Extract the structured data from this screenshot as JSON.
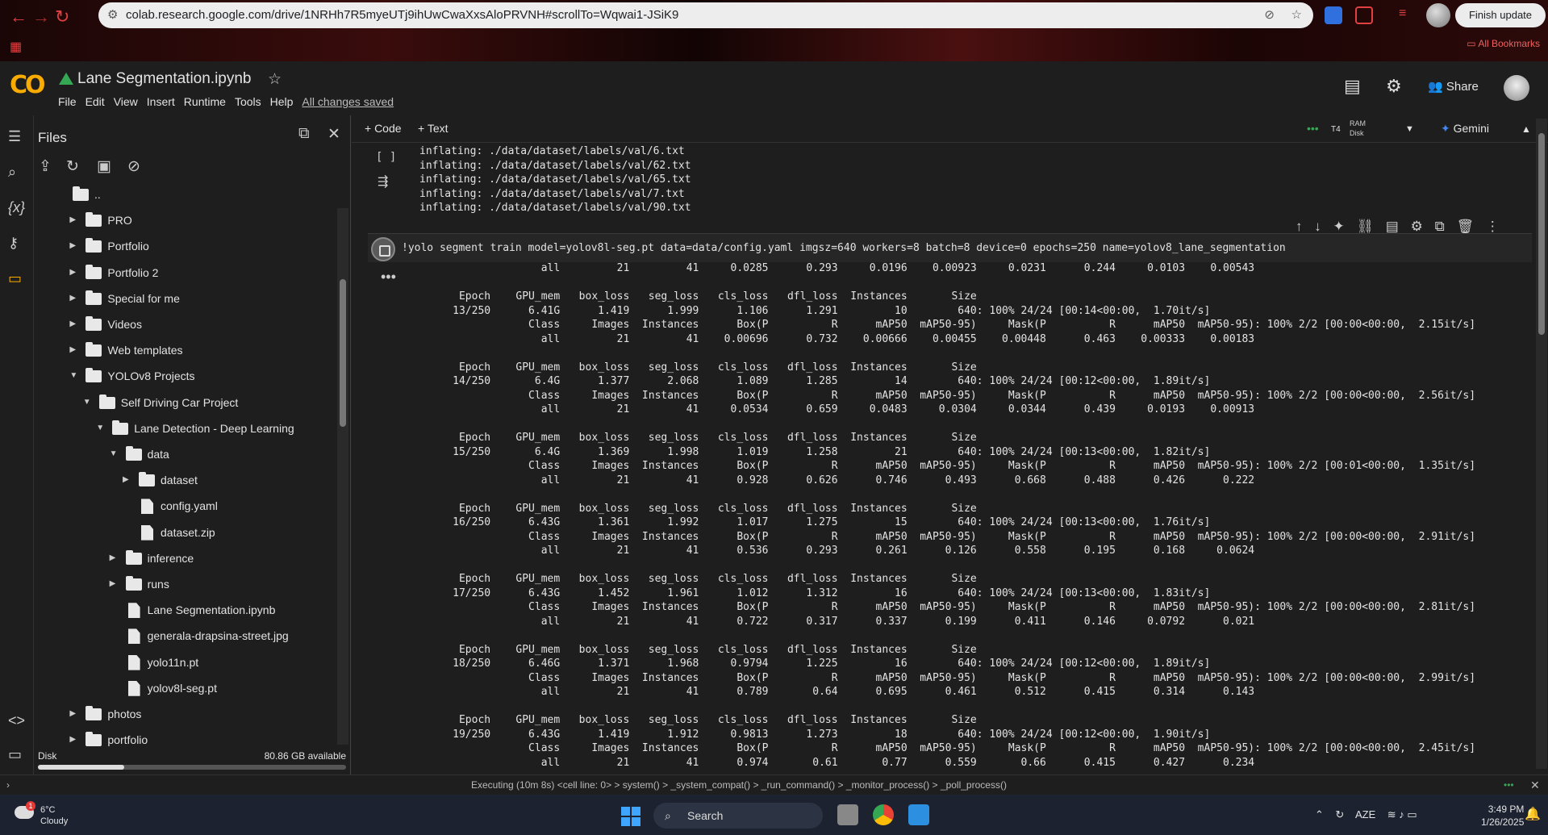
{
  "browser": {
    "url": "colab.research.google.com/drive/1NRHh7R5myeUTj9ihUwCwaXxsAloPRVNH#scrollTo=Wqwai1-JSiK9",
    "finish_update": "Finish update",
    "all_bookmarks": "All Bookmarks"
  },
  "colab": {
    "title": "Lane Segmentation.ipynb",
    "menu": [
      "File",
      "Edit",
      "View",
      "Insert",
      "Runtime",
      "Tools",
      "Help"
    ],
    "saved_status": "All changes saved",
    "share": "Share"
  },
  "files": {
    "title": "Files",
    "disk_label": "Disk",
    "disk_available": "80.86 GB available",
    "disk_used_fraction": 0.28,
    "tree": [
      {
        "name": "..",
        "indent": 0,
        "type": "folder",
        "chevron": ""
      },
      {
        "name": "PRO",
        "indent": 1,
        "type": "folder",
        "chevron": "right"
      },
      {
        "name": "Portfolio",
        "indent": 1,
        "type": "folder",
        "chevron": "right"
      },
      {
        "name": "Portfolio 2",
        "indent": 1,
        "type": "folder",
        "chevron": "right"
      },
      {
        "name": "Special for me",
        "indent": 1,
        "type": "folder",
        "chevron": "right"
      },
      {
        "name": "Videos",
        "indent": 1,
        "type": "folder",
        "chevron": "right"
      },
      {
        "name": "Web templates",
        "indent": 1,
        "type": "folder",
        "chevron": "right"
      },
      {
        "name": "YOLOv8 Projects",
        "indent": 1,
        "type": "folder",
        "chevron": "down"
      },
      {
        "name": "Self Driving Car Project",
        "indent": 2,
        "type": "folder",
        "chevron": "down"
      },
      {
        "name": "Lane Detection - Deep Learning",
        "indent": 3,
        "type": "folder",
        "chevron": "down"
      },
      {
        "name": "data",
        "indent": 4,
        "type": "folder",
        "chevron": "down"
      },
      {
        "name": "dataset",
        "indent": 5,
        "type": "folder",
        "chevron": "right"
      },
      {
        "name": "config.yaml",
        "indent": 5,
        "type": "file",
        "chevron": ""
      },
      {
        "name": "dataset.zip",
        "indent": 5,
        "type": "file",
        "chevron": ""
      },
      {
        "name": "inference",
        "indent": 4,
        "type": "folder",
        "chevron": "right"
      },
      {
        "name": "runs",
        "indent": 4,
        "type": "folder",
        "chevron": "right"
      },
      {
        "name": "Lane Segmentation.ipynb",
        "indent": 4,
        "type": "file",
        "chevron": ""
      },
      {
        "name": "generala-drapsina-street.jpg",
        "indent": 4,
        "type": "file",
        "chevron": ""
      },
      {
        "name": "yolo11n.pt",
        "indent": 4,
        "type": "file",
        "chevron": ""
      },
      {
        "name": "yolov8l-seg.pt",
        "indent": 4,
        "type": "file",
        "chevron": ""
      },
      {
        "name": "photos",
        "indent": 1,
        "type": "folder",
        "chevron": "right"
      },
      {
        "name": "portfolio",
        "indent": 1,
        "type": "folder",
        "chevron": "right"
      }
    ]
  },
  "toolbar": {
    "code": "+ Code",
    "text": "+ Text",
    "gpu": "T4",
    "ram": "RAM",
    "disk": "Disk",
    "gemini": "Gemini"
  },
  "cell": {
    "bracket": "[ ]",
    "top_output": "inflating: ./data/dataset/labels/val/6.txt\ninflating: ./data/dataset/labels/val/62.txt\ninflating: ./data/dataset/labels/val/65.txt\ninflating: ./data/dataset/labels/val/7.txt\ninflating: ./data/dataset/labels/val/90.txt",
    "code": "!yolo segment train model=yolov8l-seg.pt data=data/config.yaml imgsz=640 workers=8 batch=8 device=0 epochs=250 name=yolov8_lane_segmentation",
    "output": "                   all         21         41     0.0285      0.293     0.0196    0.00923     0.0231      0.244     0.0103    0.00543\n\n      Epoch    GPU_mem   box_loss   seg_loss   cls_loss   dfl_loss  Instances       Size\n     13/250      6.41G      1.419      1.999      1.106      1.291         10        640: 100% 24/24 [00:14<00:00,  1.70it/s]\n                 Class     Images  Instances      Box(P          R      mAP50  mAP50-95)     Mask(P          R      mAP50  mAP50-95): 100% 2/2 [00:00<00:00,  2.15it/s]\n                   all         21         41    0.00696      0.732    0.00666    0.00455    0.00448      0.463    0.00333    0.00183\n\n      Epoch    GPU_mem   box_loss   seg_loss   cls_loss   dfl_loss  Instances       Size\n     14/250       6.4G      1.377      2.068      1.089      1.285         14        640: 100% 24/24 [00:12<00:00,  1.89it/s]\n                 Class     Images  Instances      Box(P          R      mAP50  mAP50-95)     Mask(P          R      mAP50  mAP50-95): 100% 2/2 [00:00<00:00,  2.56it/s]\n                   all         21         41     0.0534      0.659     0.0483     0.0304     0.0344      0.439     0.0193    0.00913\n\n      Epoch    GPU_mem   box_loss   seg_loss   cls_loss   dfl_loss  Instances       Size\n     15/250       6.4G      1.369      1.998      1.019      1.258         21        640: 100% 24/24 [00:13<00:00,  1.82it/s]\n                 Class     Images  Instances      Box(P          R      mAP50  mAP50-95)     Mask(P          R      mAP50  mAP50-95): 100% 2/2 [00:01<00:00,  1.35it/s]\n                   all         21         41      0.928      0.626      0.746      0.493      0.668      0.488      0.426      0.222\n\n      Epoch    GPU_mem   box_loss   seg_loss   cls_loss   dfl_loss  Instances       Size\n     16/250      6.43G      1.361      1.992      1.017      1.275         15        640: 100% 24/24 [00:13<00:00,  1.76it/s]\n                 Class     Images  Instances      Box(P          R      mAP50  mAP50-95)     Mask(P          R      mAP50  mAP50-95): 100% 2/2 [00:00<00:00,  2.91it/s]\n                   all         21         41      0.536      0.293      0.261      0.126      0.558      0.195      0.168     0.0624\n\n      Epoch    GPU_mem   box_loss   seg_loss   cls_loss   dfl_loss  Instances       Size\n     17/250      6.43G      1.452      1.961      1.012      1.312         16        640: 100% 24/24 [00:13<00:00,  1.83it/s]\n                 Class     Images  Instances      Box(P          R      mAP50  mAP50-95)     Mask(P          R      mAP50  mAP50-95): 100% 2/2 [00:00<00:00,  2.81it/s]\n                   all         21         41      0.722      0.317      0.337      0.199      0.411      0.146     0.0792      0.021\n\n      Epoch    GPU_mem   box_loss   seg_loss   cls_loss   dfl_loss  Instances       Size\n     18/250      6.46G      1.371      1.968     0.9794      1.225         16        640: 100% 24/24 [00:12<00:00,  1.89it/s]\n                 Class     Images  Instances      Box(P          R      mAP50  mAP50-95)     Mask(P          R      mAP50  mAP50-95): 100% 2/2 [00:00<00:00,  2.99it/s]\n                   all         21         41      0.789       0.64      0.695      0.461      0.512      0.415      0.314      0.143\n\n      Epoch    GPU_mem   box_loss   seg_loss   cls_loss   dfl_loss  Instances       Size\n     19/250      6.43G      1.419      1.912     0.9813      1.273         18        640: 100% 24/24 [00:12<00:00,  1.90it/s]\n                 Class     Images  Instances      Box(P          R      mAP50  mAP50-95)     Mask(P          R      mAP50  mAP50-95): 100% 2/2 [00:00<00:00,  2.45it/s]\n                   all         21         41      0.974       0.61       0.77      0.559       0.66      0.415      0.427      0.234"
  },
  "status": {
    "text": "Executing (10m 8s)  <cell line: 0> > system() > _system_compat() > _run_command() > _monitor_process() > _poll_process()"
  },
  "taskbar": {
    "temp": "6°C",
    "condition": "Cloudy",
    "badge": "1",
    "search": "Search",
    "lang": "AZE",
    "time": "3:49 PM",
    "date": "1/26/2025"
  },
  "colors": {
    "accent": "#f9ab00",
    "chrome_red": "#e04040",
    "gemini": "#4285f4"
  }
}
